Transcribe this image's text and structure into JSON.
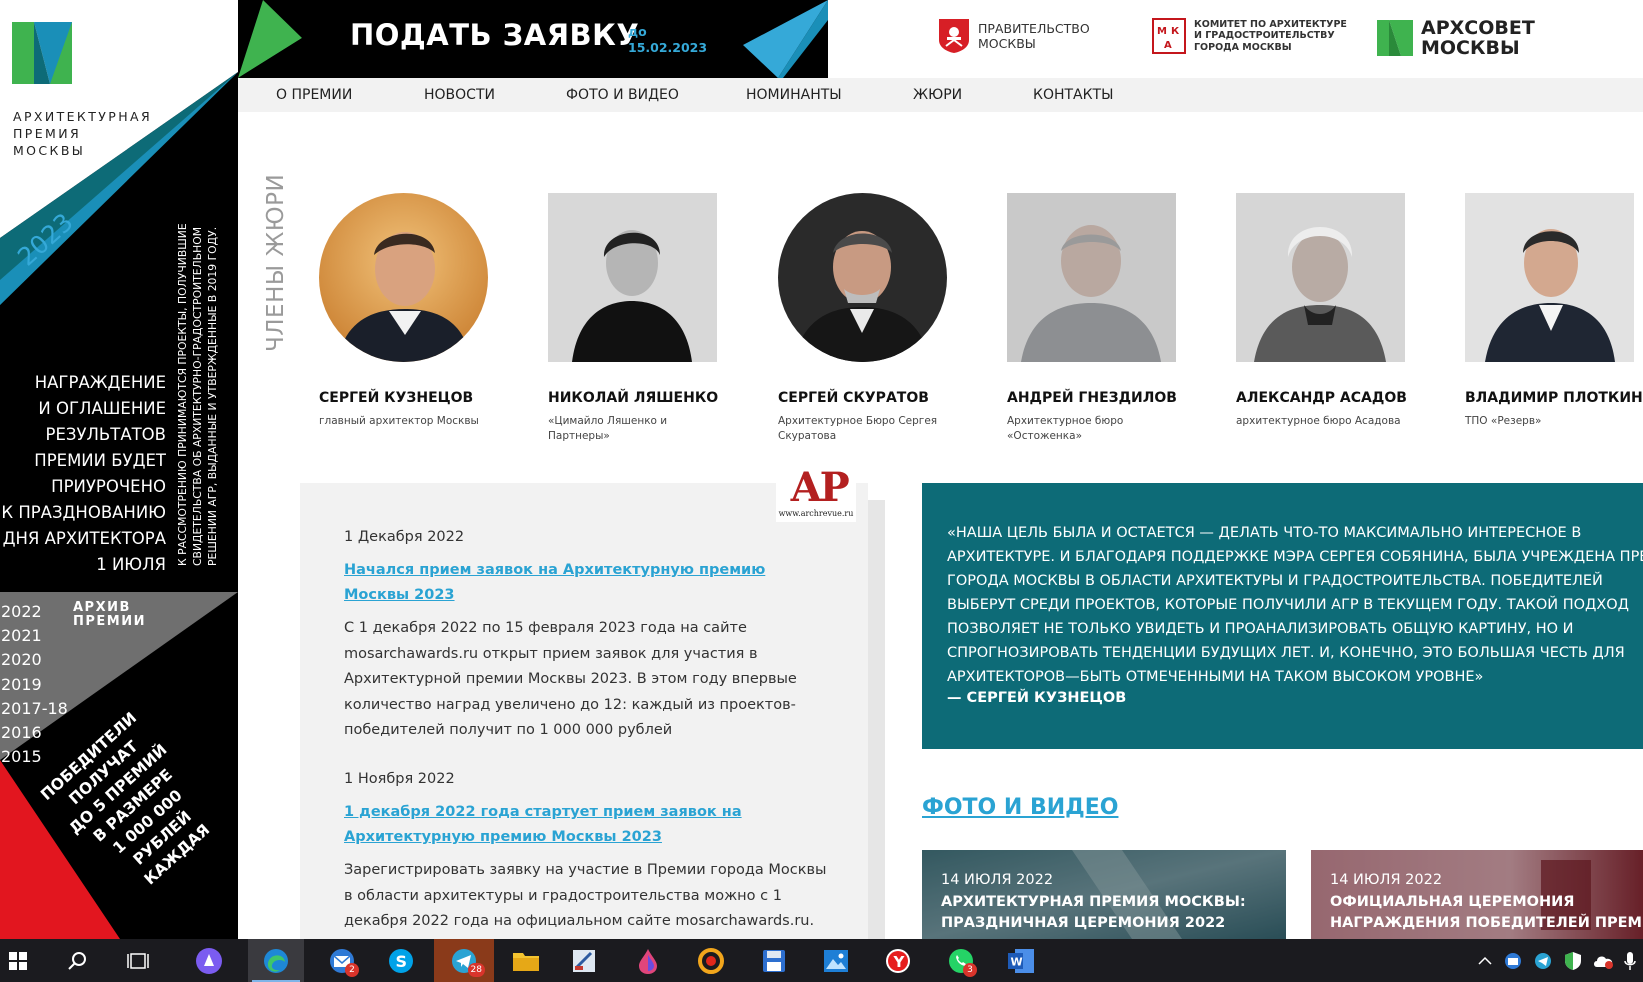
{
  "sidebar": {
    "logo_lines": [
      "АРХИТЕКТУРНАЯ",
      "ПРЕМИЯ",
      "МОСКВЫ"
    ],
    "year": "2023",
    "vertical_note": [
      "К РАССМОТРЕНИЮ ПРИНИМАЮТСЯ ПРОЕКТЫ, ПОЛУЧИВШИЕ",
      "СВИДЕТЕЛЬСТВА ОБ АРХИТЕКТУРНО-ГРАДОСТРОИТЕЛЬНОМ",
      "РЕШЕНИИ АГР, ВЫДАННЫЕ И УТВЕРЖДЕННЫЕ В 2019 ГОДУ."
    ],
    "award_text": [
      "НАГРАЖДЕНИЕ",
      "И ОГЛАШЕНИЕ",
      "РЕЗУЛЬТАТОВ",
      "ПРЕМИИ БУДЕТ",
      "ПРИУРОЧЕНО",
      "К ПРАЗДНОВАНИЮ",
      "ДНЯ АРХИТЕКТОРА",
      "1 ИЮЛЯ"
    ],
    "archive_title_lines": [
      "АРХИВ",
      "ПРЕМИИ"
    ],
    "archive_years": [
      "2022",
      "2021",
      "2020",
      "2019",
      "2017-18",
      "2016",
      "2015"
    ],
    "winners_text": [
      "ПОБЕДИТЕЛИ",
      "ПОЛУЧАТ",
      "ДО 5 ПРЕМИЙ",
      "В РАЗМЕРЕ",
      "1 000 000",
      "РУБЛЕЙ",
      "КАЖДАЯ"
    ]
  },
  "banner": {
    "apply_label": "ПОДАТЬ ЗАЯВКУ",
    "deadline_prefix": "до",
    "deadline_date": "15.02.2023"
  },
  "partners": {
    "government": [
      "ПРАВИТЕЛЬСТВО",
      "МОСКВЫ"
    ],
    "mka": [
      "КОМИТЕТ ПО АРХИТЕКТУРЕ",
      "И ГРАДОСТРОИТЕЛЬСТВУ",
      "ГОРОДА МОСКВЫ"
    ],
    "archsovet": [
      "АРХСОВЕТ",
      "МОСКВЫ"
    ]
  },
  "nav": {
    "items": [
      "О ПРЕМИИ",
      "НОВОСТИ",
      "ФОТО И ВИДЕО",
      "НОМИНАНТЫ",
      "ЖЮРИ",
      "КОНТАКТЫ"
    ]
  },
  "jury": {
    "title": "ЧЛЕНЫ ЖЮРИ",
    "members": [
      {
        "name": "СЕРГЕЙ КУЗНЕЦОВ",
        "org": "главный архитектор Москвы"
      },
      {
        "name": "НИКОЛАЙ ЛЯШЕНКО",
        "org": "«Цимайло Ляшенко и Партнеры»"
      },
      {
        "name": "СЕРГЕЙ СКУРАТОВ",
        "org": "Архитектурное Бюро Сергея Скуратова"
      },
      {
        "name": "АНДРЕЙ ГНЕЗДИЛОВ",
        "org": "Архитектурное бюро «Остоженка»"
      },
      {
        "name": "АЛЕКСАНДР АСАДОВ",
        "org": "архитектурное бюро Асадова"
      },
      {
        "name": "ВЛАДИМИР ПЛОТКИН",
        "org": "ТПО «Резерв»"
      }
    ]
  },
  "watermark": {
    "letters": "АР",
    "url": "www.archrevue.ru"
  },
  "news": [
    {
      "date": "1 Декабря 2022",
      "title": "Начался прием заявок на Архитектурную премию Москвы 2023",
      "body": "С 1 декабря 2022 по 15 февраля 2023 года на сайте mosarchawards.ru открыт прием заявок для участия в Архитектурной премии Москвы 2023. В этом году впервые количество наград увеличено до 12: каждый из проектов-победителей получит по 1 000 000 рублей"
    },
    {
      "date": "1 Ноября 2022",
      "title": "1 декабря 2022 года стартует прием заявок на Архитектурную премию Москвы 2023",
      "body": "Зарегистрировать заявку на участие в Премии города Москвы в области архитектуры и градостроительства можно с 1 декабря 2022 года на официальном сайте mosarchawards.ru."
    }
  ],
  "quote": {
    "lines": [
      "«НАША ЦЕЛЬ БЫЛА И ОСТАЕТСЯ — ДЕЛАТЬ ЧТО-ТО МАКСИМАЛЬНО ИНТЕРЕСНОЕ В",
      "АРХИТЕКТУРЕ. И БЛАГОДАРЯ ПОДДЕРЖКЕ МЭРА СЕРГЕЯ СОБЯНИНА, БЫЛА УЧРЕЖДЕНА ПРЕМИЯ",
      "ГОРОДА МОСКВЫ В ОБЛАСТИ АРХИТЕКТУРЫ И ГРАДОСТРОИТЕЛЬСТВА. ПОБЕДИТЕЛЕЙ",
      "ВЫБЕРУТ СРЕДИ ПРОЕКТОВ, КОТОРЫЕ ПОЛУЧИЛИ АГР В ТЕКУЩЕМ ГОДУ. ТАКОЙ ПОДХОД",
      "ПОЗВОЛЯЕТ НЕ ТОЛЬКО УВИДЕТЬ И ПРОАНАЛИЗИРОВАТЬ ОБЩУЮ КАРТИНУ, НО И",
      "СПРОГНОЗИРОВАТЬ ТЕНДЕНЦИИ БУДУЩИХ ЛЕТ. И, КОНЕЧНО, ЭТО БОЛЬШАЯ ЧЕСТЬ ДЛЯ",
      "АРХИТЕКТОРОВ—БЫТЬ ОТМЕЧЕННЫМИ НА ТАКОМ ВЫСОКОМ УРОВНЕ»"
    ],
    "author": "— СЕРГЕЙ КУЗНЕЦОВ"
  },
  "photo_video": {
    "title": "ФОТО И ВИДЕО",
    "cards": [
      {
        "date": "14 ИЮЛЯ 2022",
        "head": [
          "АРХИТЕКТУРНАЯ ПРЕМИЯ МОСКВЫ:",
          "ПРАЗДНИЧНАЯ ЦЕРЕМОНИЯ 2022"
        ]
      },
      {
        "date": "14 ИЮЛЯ 2022",
        "head": [
          "ОФИЦИАЛЬНАЯ ЦЕРЕМОНИЯ",
          "НАГРАЖДЕНИЯ ПОБЕДИТЕЛЕЙ ПРЕМИИ"
        ]
      }
    ]
  },
  "taskbar": {
    "badges": {
      "mail": "2",
      "telegram": "28",
      "whatsapp": "3"
    }
  },
  "colors": {
    "teal": "#0d6b77",
    "link_blue": "#2aa3d3",
    "green": "#3fb34f",
    "sidebar_black": "#000000",
    "winners_red": "#e2161f"
  }
}
